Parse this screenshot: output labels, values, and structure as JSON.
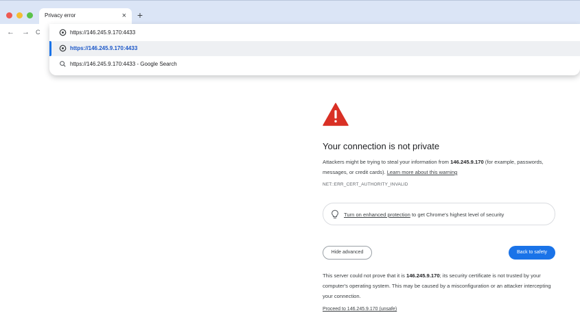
{
  "window": {
    "tab": {
      "title": "Privacy error",
      "close_glyph": "×"
    },
    "new_tab_glyph": "+"
  },
  "toolbar": {
    "back_glyph": "←",
    "forward_glyph": "→",
    "reload_glyph": "C"
  },
  "omnibox": {
    "input_value": "https://146.245.9.170:4433",
    "suggestions": [
      {
        "icon": "globe-icon",
        "text": "https://146.245.9.170:4433",
        "selected": true
      },
      {
        "icon": "search-icon",
        "text": "https://146.245.9.170:4433 - Google Search",
        "selected": false
      }
    ]
  },
  "interstitial": {
    "warning_icon": "warning-triangle-icon",
    "heading": "Your connection is not private",
    "para1_prefix": "Attackers might be trying to steal your information from ",
    "host": "146.245.9.170",
    "para1_suffix": " (for example, passwords, messages, or credit cards). ",
    "learn_more": "Learn more about this warning",
    "error_code": "NET::ERR_CERT_AUTHORITY_INVALID",
    "protection_link": "Turn on enhanced protection",
    "protection_suffix": " to get Chrome's highest level of security",
    "hide_advanced": "Hide advanced",
    "back_to_safety": "Back to safety",
    "para3_prefix": "This server could not prove that it is ",
    "para3_suffix": "; its security certificate is not trusted by your computer's operating system. This may be caused by a misconfiguration or an attacker intercepting your connection.",
    "proceed": "Proceed to 146.245.9.170 (unsafe)"
  },
  "colors": {
    "accent": "#1a73e8",
    "warning": "#d93025",
    "titlebar": "#dbe5f6"
  }
}
